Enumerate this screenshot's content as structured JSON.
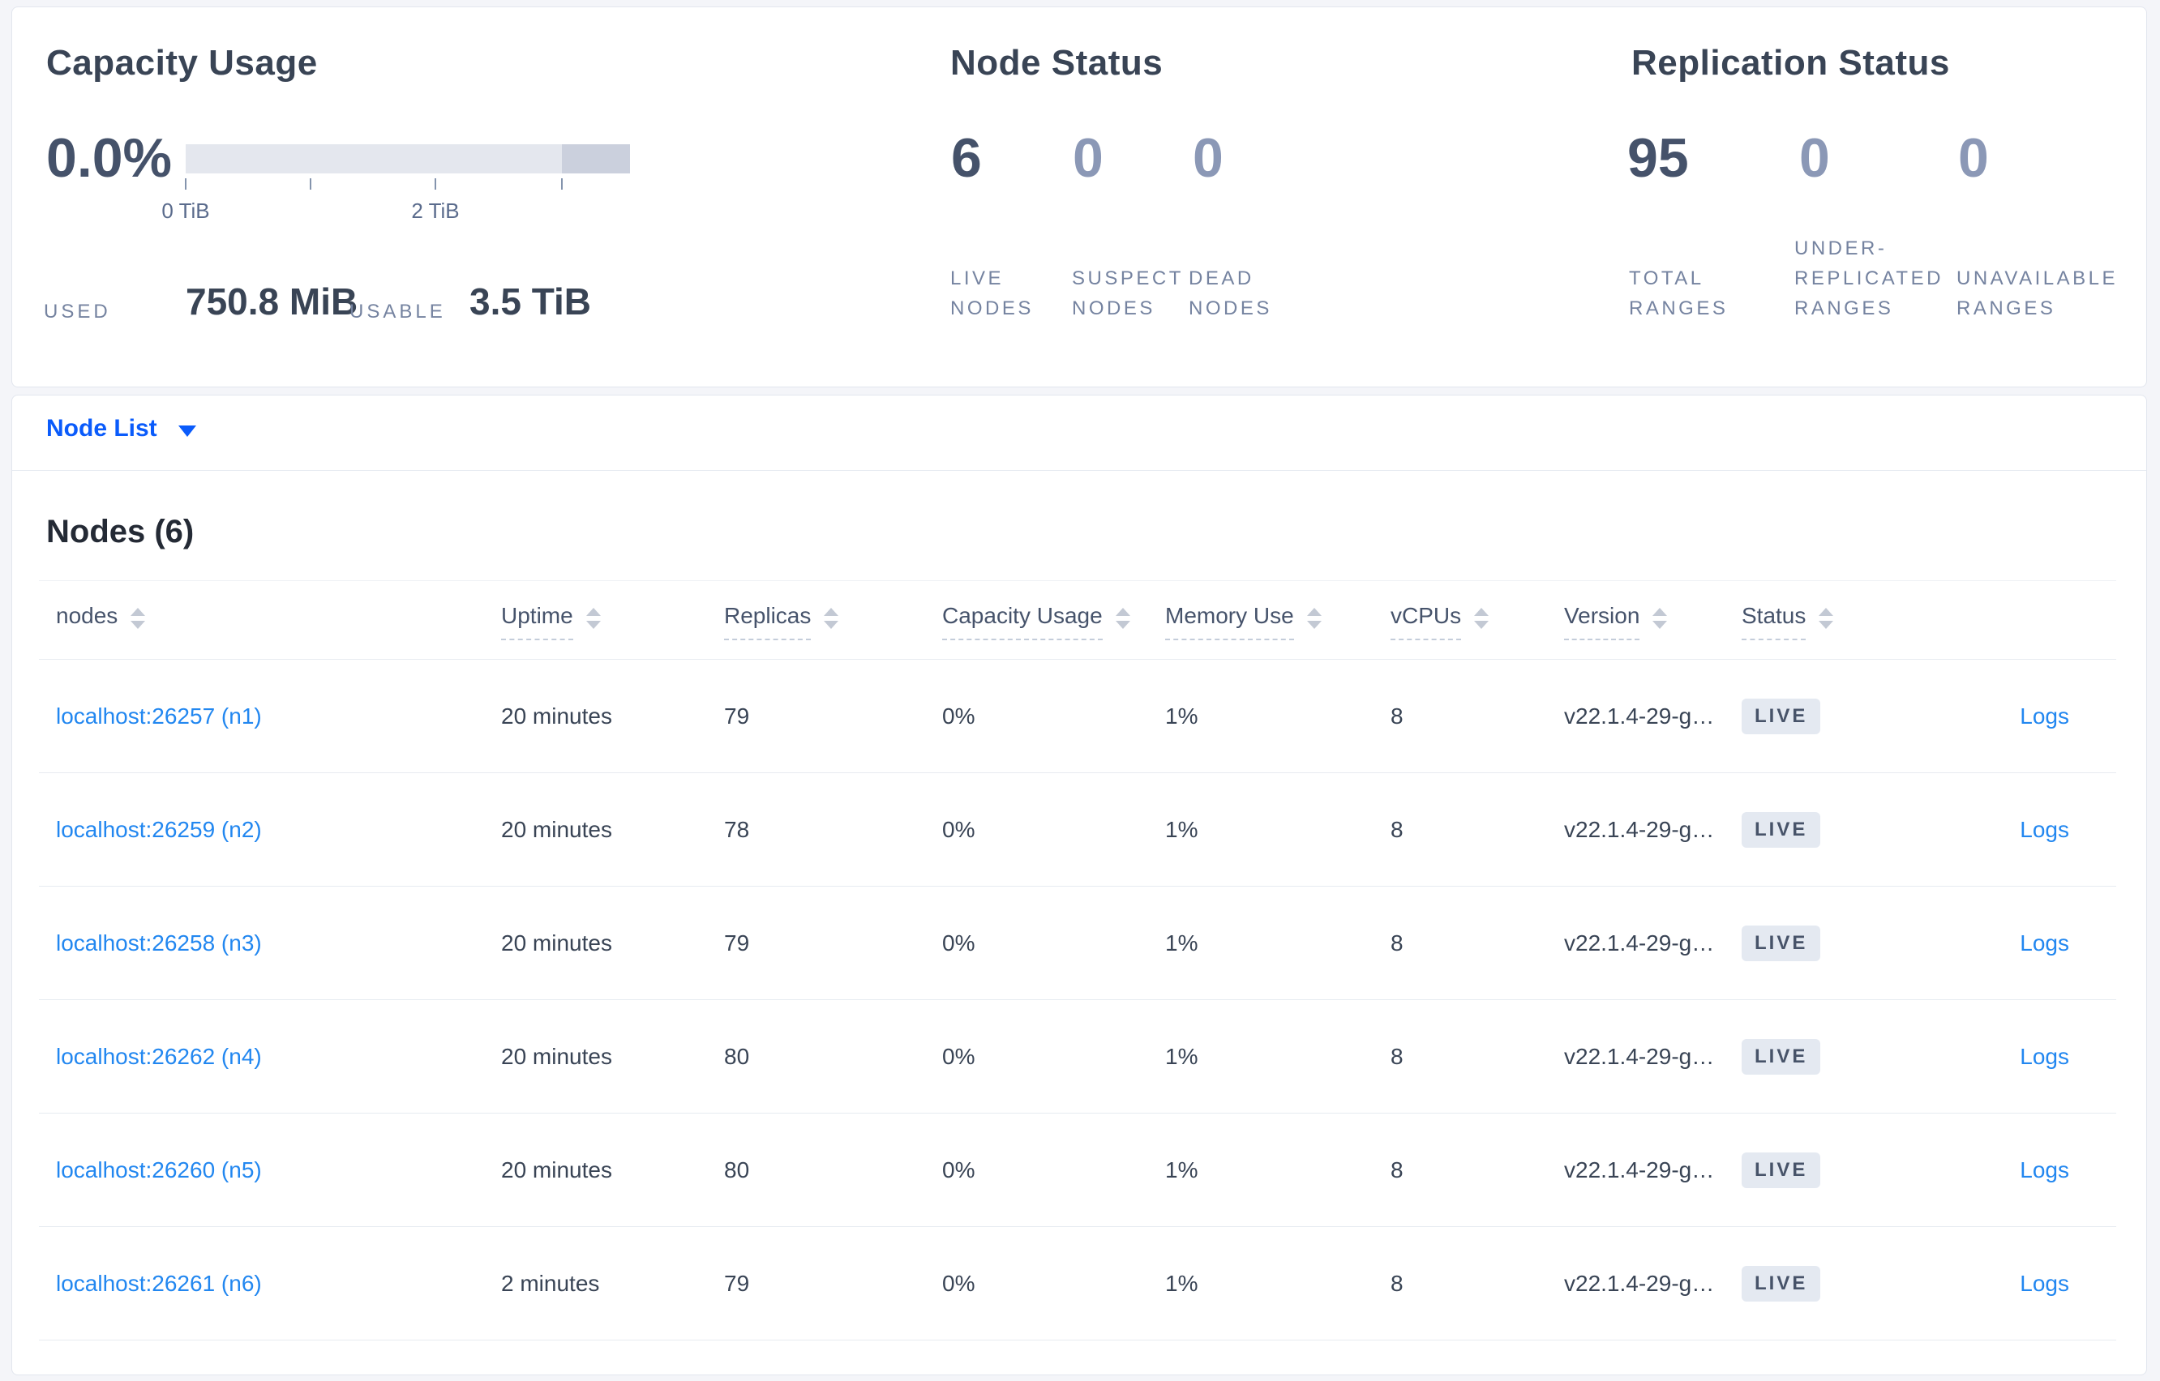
{
  "summary": {
    "capacity": {
      "title": "Capacity Usage",
      "percent": "0.0%",
      "axis_tick_0": "0 TiB",
      "axis_tick_2": "2 TiB",
      "used_label": "USED",
      "used_value": "750.8 MiB",
      "usable_label": "USABLE",
      "usable_value": "3.5 TiB",
      "bar_light_color": "#e4e7ee",
      "bar_dark_color": "#cbd0dd"
    },
    "node_status": {
      "title": "Node Status",
      "metrics": [
        {
          "value": "6",
          "label": [
            "LIVE",
            "NODES"
          ],
          "emphasized": true
        },
        {
          "value": "0",
          "label": [
            "SUSPECT",
            "NODES"
          ],
          "emphasized": false
        },
        {
          "value": "0",
          "label": [
            "DEAD",
            "NODES"
          ],
          "emphasized": false
        }
      ]
    },
    "replication_status": {
      "title": "Replication Status",
      "metrics": [
        {
          "value": "95",
          "label": [
            "TOTAL",
            "RANGES"
          ],
          "emphasized": true
        },
        {
          "value": "0",
          "label": [
            "UNDER-",
            "REPLICATED",
            "RANGES"
          ],
          "emphasized": false
        },
        {
          "value": "0",
          "label": [
            "UNAVAILABLE",
            "RANGES"
          ],
          "emphasized": false
        }
      ]
    }
  },
  "node_list": {
    "dropdown_label": "Node List",
    "section_title": "Nodes (6)",
    "columns": [
      {
        "label": "nodes",
        "underlined": false
      },
      {
        "label": "Uptime",
        "underlined": true
      },
      {
        "label": "Replicas",
        "underlined": true
      },
      {
        "label": "Capacity Usage",
        "underlined": true
      },
      {
        "label": "Memory Use",
        "underlined": true
      },
      {
        "label": "vCPUs",
        "underlined": true
      },
      {
        "label": "Version",
        "underlined": true
      },
      {
        "label": "Status",
        "underlined": true
      }
    ],
    "rows": [
      {
        "address": "localhost:26257 (n1)",
        "uptime": "20 minutes",
        "replicas": "79",
        "capacity_usage": "0%",
        "memory_use": "1%",
        "vcpus": "8",
        "version": "v22.1.4-29-g…",
        "status": "LIVE",
        "logs_label": "Logs"
      },
      {
        "address": "localhost:26259 (n2)",
        "uptime": "20 minutes",
        "replicas": "78",
        "capacity_usage": "0%",
        "memory_use": "1%",
        "vcpus": "8",
        "version": "v22.1.4-29-g…",
        "status": "LIVE",
        "logs_label": "Logs"
      },
      {
        "address": "localhost:26258 (n3)",
        "uptime": "20 minutes",
        "replicas": "79",
        "capacity_usage": "0%",
        "memory_use": "1%",
        "vcpus": "8",
        "version": "v22.1.4-29-g…",
        "status": "LIVE",
        "logs_label": "Logs"
      },
      {
        "address": "localhost:26262 (n4)",
        "uptime": "20 minutes",
        "replicas": "80",
        "capacity_usage": "0%",
        "memory_use": "1%",
        "vcpus": "8",
        "version": "v22.1.4-29-g…",
        "status": "LIVE",
        "logs_label": "Logs"
      },
      {
        "address": "localhost:26260 (n5)",
        "uptime": "20 minutes",
        "replicas": "80",
        "capacity_usage": "0%",
        "memory_use": "1%",
        "vcpus": "8",
        "version": "v22.1.4-29-g…",
        "status": "LIVE",
        "logs_label": "Logs"
      },
      {
        "address": "localhost:26261 (n6)",
        "uptime": "2 minutes",
        "replicas": "79",
        "capacity_usage": "0%",
        "memory_use": "1%",
        "vcpus": "8",
        "version": "v22.1.4-29-g…",
        "status": "LIVE",
        "logs_label": "Logs"
      }
    ],
    "colors": {
      "primary_link": "#0a5bfb",
      "row_link": "#2287f0",
      "badge_bg": "#e4e9f1",
      "badge_text": "#475369"
    }
  }
}
